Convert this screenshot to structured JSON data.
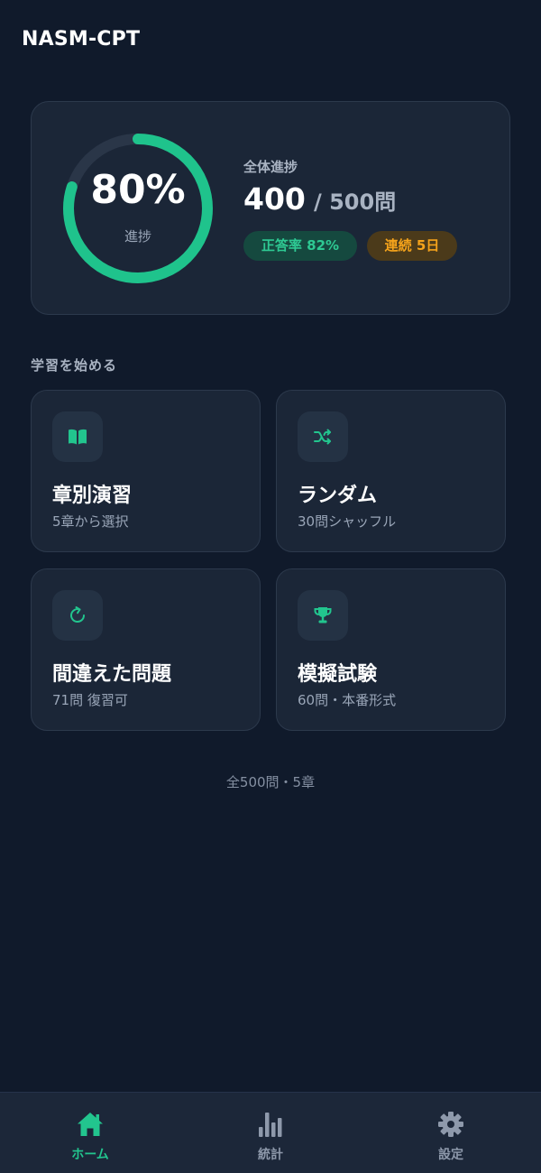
{
  "header": {
    "title": "NASM-CPT"
  },
  "progress": {
    "percent_text": "80%",
    "percent_value": 0.8,
    "ring_label": "進捗",
    "overall_label": "全体進捗",
    "done": "400",
    "total": "/ 500問",
    "accuracy_badge": "正答率 82%",
    "streak_badge": "連続 5日"
  },
  "section_title": "学習を始める",
  "modes": [
    {
      "title": "章別演習",
      "subtitle": "5章から選択",
      "icon": "book-icon"
    },
    {
      "title": "ランダム",
      "subtitle": "30問シャッフル",
      "icon": "shuffle-icon"
    },
    {
      "title": "間違えた問題",
      "subtitle": "71問 復習可",
      "icon": "retry-icon"
    },
    {
      "title": "模擬試験",
      "subtitle": "60問・本番形式",
      "icon": "trophy-icon"
    }
  ],
  "footer_note": "全500問・5章",
  "nav": {
    "items": [
      {
        "label": "ホーム",
        "icon": "home-icon",
        "active": true
      },
      {
        "label": "統計",
        "icon": "stats-icon",
        "active": false
      },
      {
        "label": "設定",
        "icon": "gear-icon",
        "active": false
      }
    ]
  },
  "colors": {
    "background": "#101a2b",
    "card": "#1b2637",
    "accent": "#22c58e",
    "streak": "#f5a31b",
    "muted": "#9aa6b8"
  }
}
